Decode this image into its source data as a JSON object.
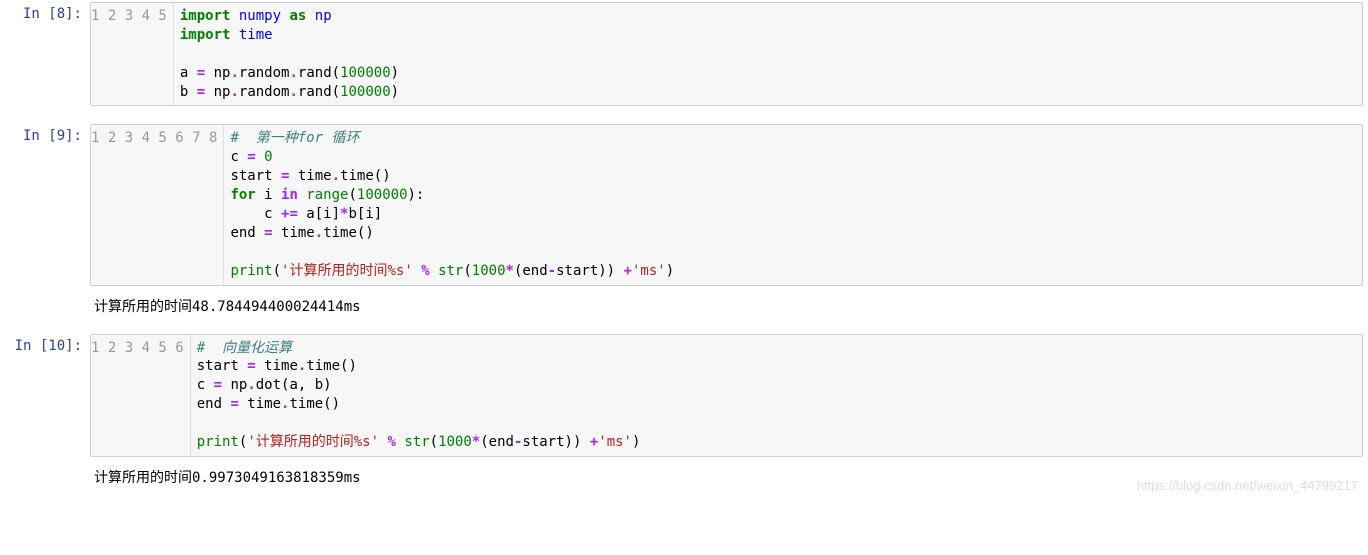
{
  "cells": [
    {
      "prompt": "In [8]:",
      "lines": [
        1,
        2,
        3,
        4,
        5
      ],
      "code_html": "<span class='kw'>import</span> <span class='bn'>numpy</span> <span class='kw'>as</span> <span class='bn'>np</span>\n<span class='kw'>import</span> <span class='bn'>time</span>\n\na <span class='op'>=</span> np<span class='op'>.</span>random<span class='op'>.</span>rand(<span class='num'>100000</span>)\nb <span class='op'>=</span> np<span class='op'>.</span>random<span class='op'>.</span>rand(<span class='num'>100000</span>)",
      "output": null
    },
    {
      "prompt": "In [9]:",
      "lines": [
        1,
        2,
        3,
        4,
        5,
        6,
        7,
        8
      ],
      "code_html": "<span class='cmt'>#  第一种for 循环</span>\nc <span class='op'>=</span> <span class='num'>0</span>\nstart <span class='op'>=</span> time<span class='op'>.</span>time()\n<span class='kw'>for</span> i <span class='op'>in</span> <span class='fn'>range</span>(<span class='num'>100000</span>):\n    c <span class='op'>+=</span> a[i]<span class='op'>*</span>b[i]\nend <span class='op'>=</span> time<span class='op'>.</span>time()\n\n<span class='fn'>print</span>(<span class='str'>'计算所用的时间%s'</span> <span class='op'>%</span> <span class='fn'>str</span>(<span class='num'>1000</span><span class='op'>*</span>(end<span class='op'>-</span>start)) <span class='op'>+</span><span class='str'>'ms'</span>)",
      "output": "计算所用的时间48.784494400024414ms"
    },
    {
      "prompt": "In [10]:",
      "lines": [
        1,
        2,
        3,
        4,
        5,
        6
      ],
      "code_html": "<span class='cmt'>#  向量化运算</span>\nstart <span class='op'>=</span> time<span class='op'>.</span>time()\nc <span class='op'>=</span> np<span class='op'>.</span>dot(a, b)\nend <span class='op'>=</span> time<span class='op'>.</span>time()\n\n<span class='fn'>print</span>(<span class='str'>'计算所用的时间%s'</span> <span class='op'>%</span> <span class='fn'>str</span>(<span class='num'>1000</span><span class='op'>*</span>(end<span class='op'>-</span>start)) <span class='op'>+</span><span class='str'>'ms'</span>)",
      "output": "计算所用的时间0.9973049163818359ms"
    }
  ],
  "watermark": "https://blog.csdn.net/weixin_44799217"
}
